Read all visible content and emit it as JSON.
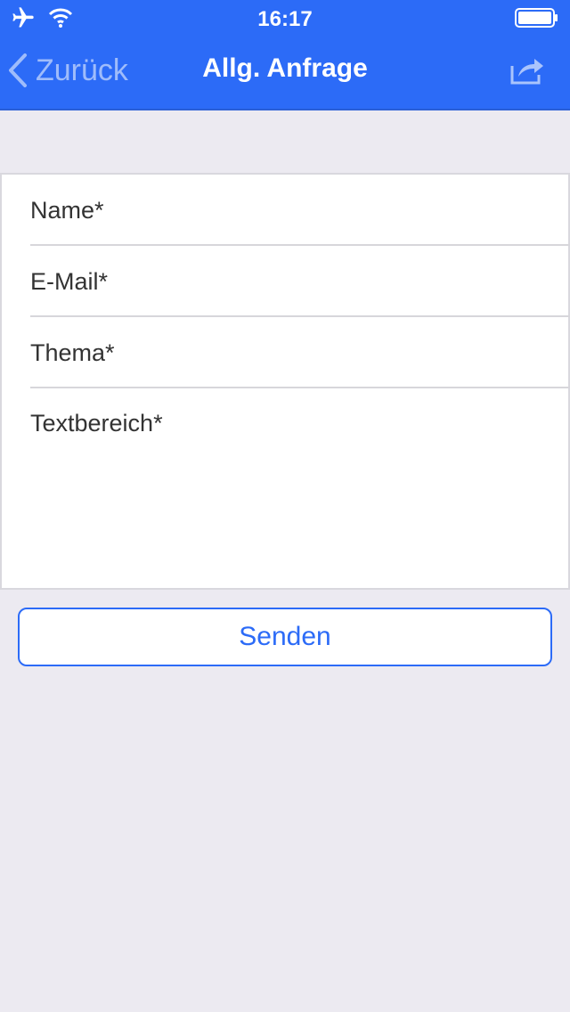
{
  "status_bar": {
    "time": "16:17",
    "icons": [
      "airplane-icon",
      "wifi-icon",
      "battery-icon"
    ]
  },
  "nav": {
    "back_label": "Zurück",
    "title": "Allg. Anfrage",
    "share_icon": "share-icon"
  },
  "form": {
    "name_placeholder": "Name*",
    "email_placeholder": "E-Mail*",
    "topic_placeholder": "Thema*",
    "text_placeholder": "Textbereich*"
  },
  "actions": {
    "submit_label": "Senden"
  },
  "colors": {
    "accent": "#2C6BF7",
    "background": "#ECEAF1",
    "text": "#333333"
  }
}
